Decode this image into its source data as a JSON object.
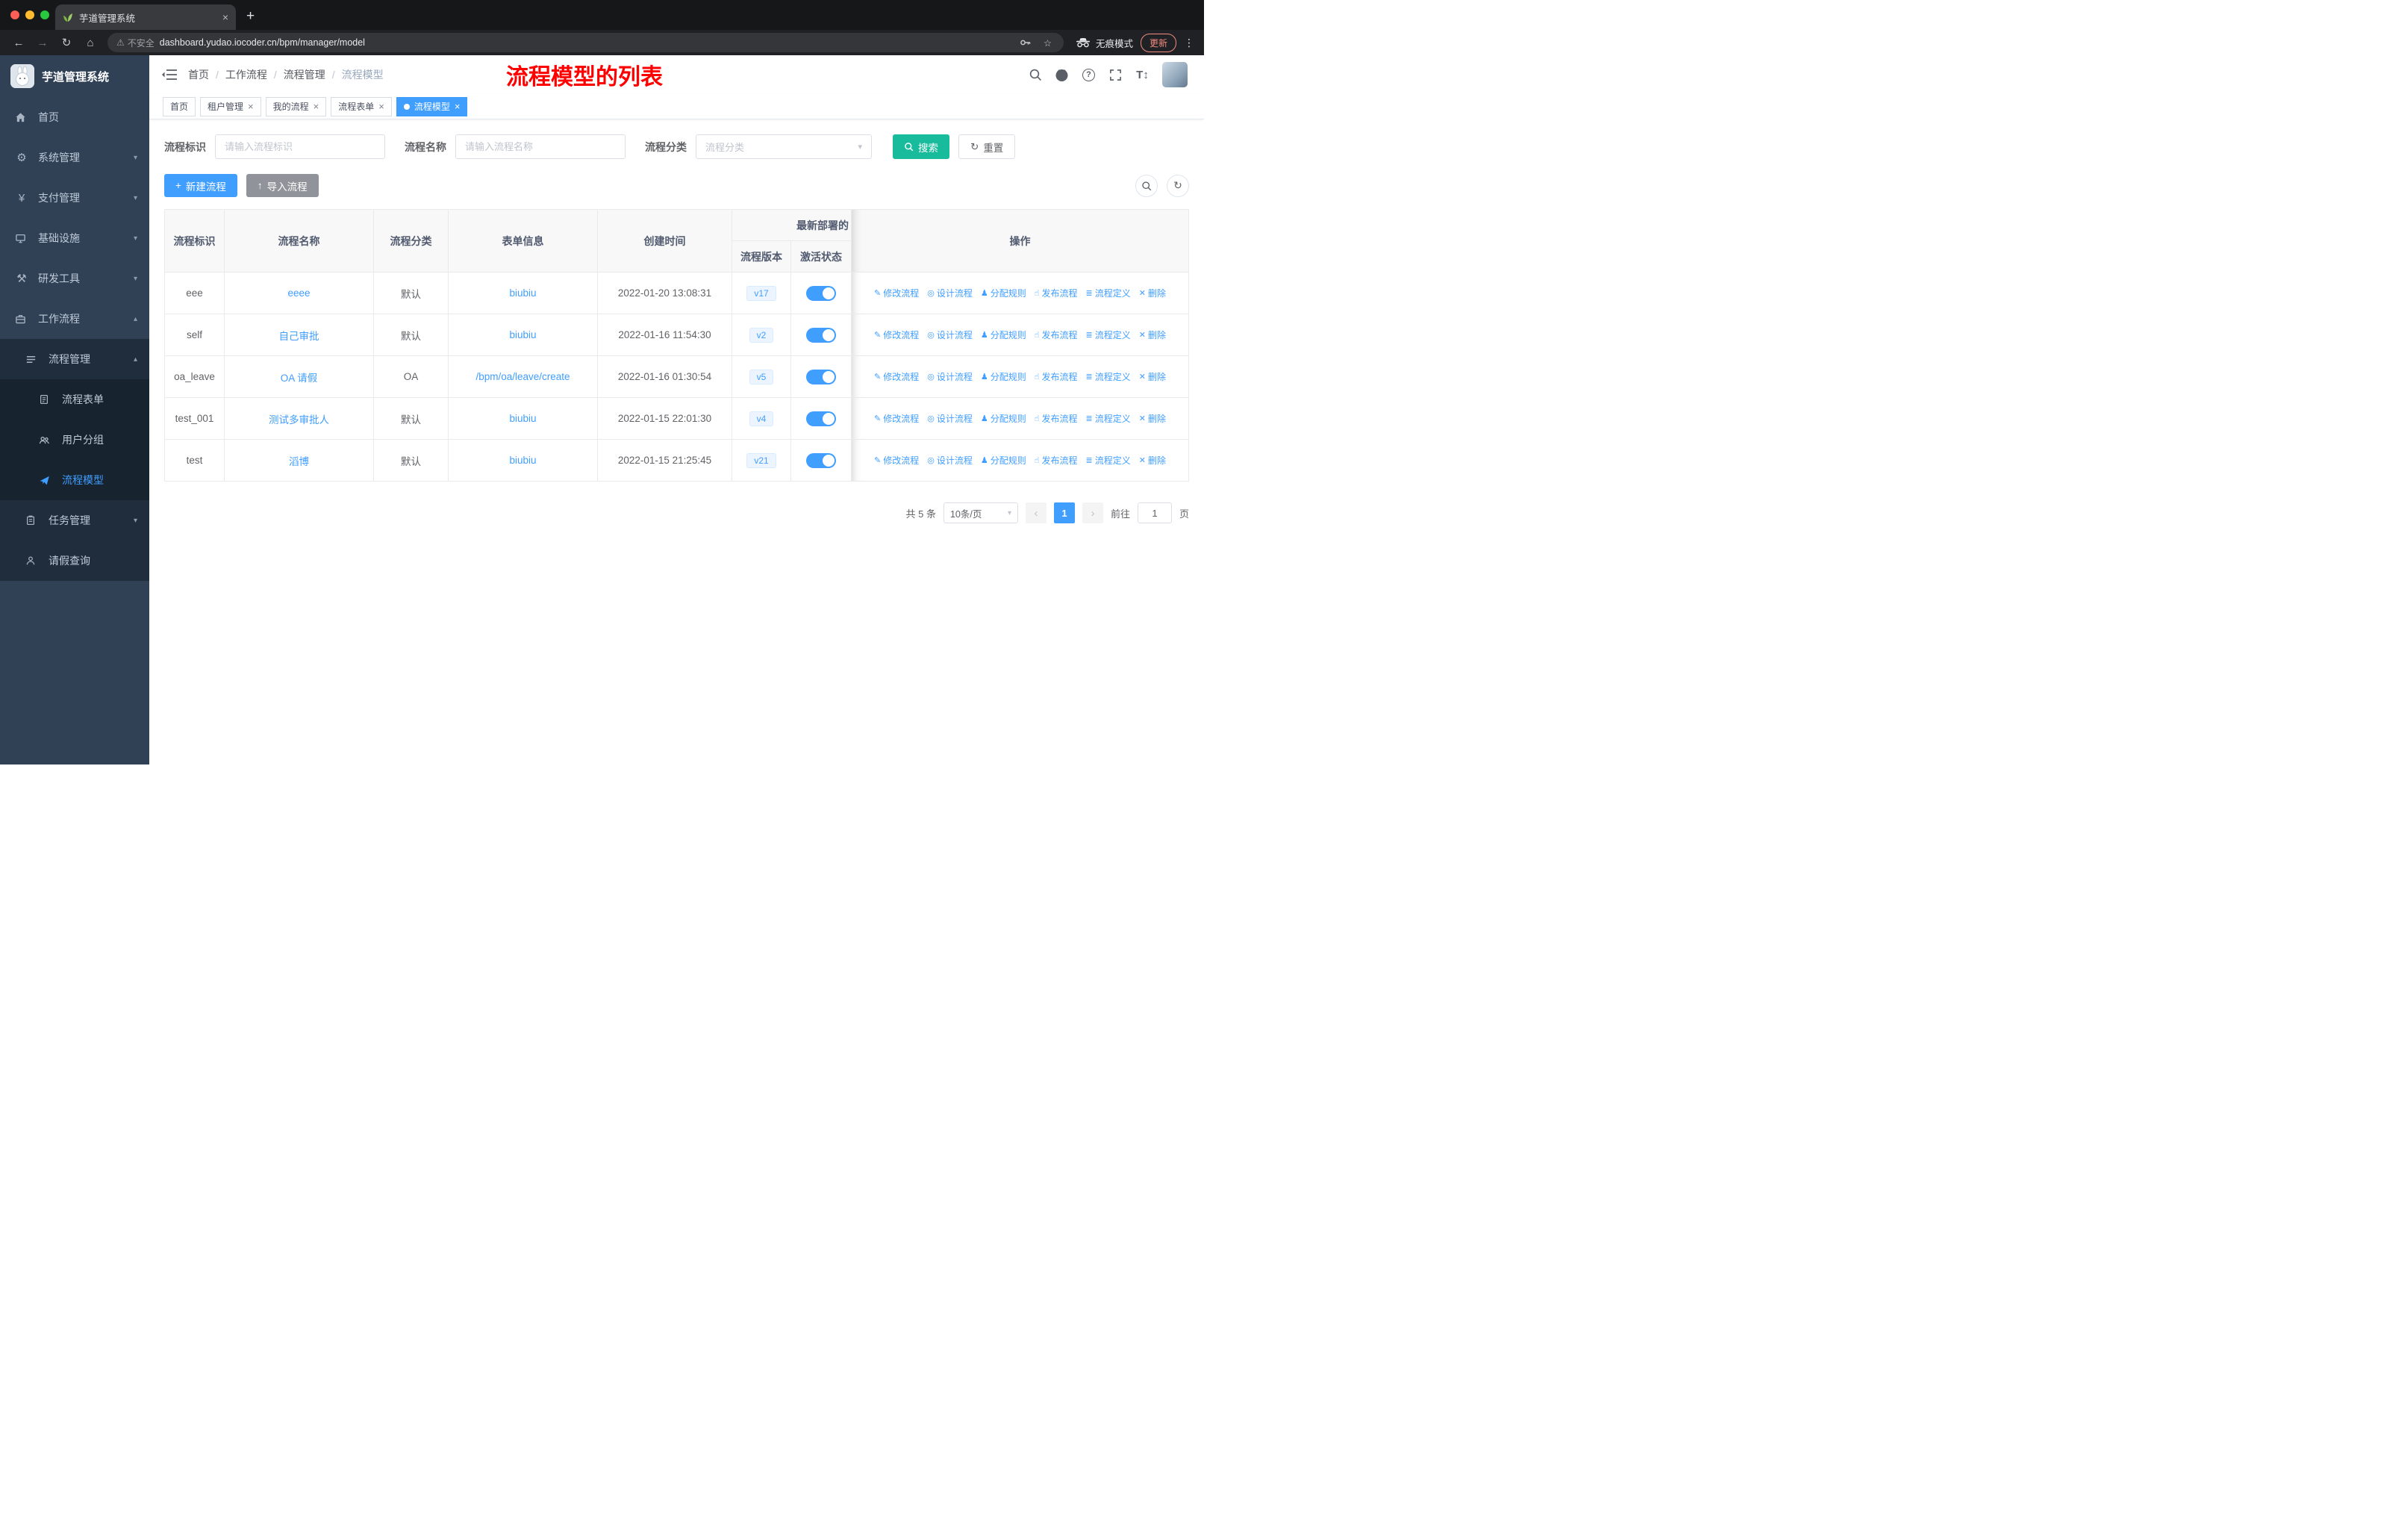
{
  "chrome": {
    "tab_title": "芋道管理系统",
    "security_label": "不安全",
    "url": "dashboard.yudao.iocoder.cn/bpm/manager/model",
    "incognito_label": "无痕模式",
    "update_label": "更新"
  },
  "sidebar": {
    "logo_title": "芋道管理系统",
    "menu": {
      "home": "首页",
      "system": "系统管理",
      "payment": "支付管理",
      "infra": "基础设施",
      "devtools": "研发工具",
      "workflow": "工作流程",
      "process_mgmt": "流程管理",
      "process_form": "流程表单",
      "user_group": "用户分组",
      "process_model": "流程模型",
      "task_mgmt": "任务管理",
      "leave_query": "请假查询"
    }
  },
  "header": {
    "breadcrumb": [
      "首页",
      "工作流程",
      "流程管理",
      "流程模型"
    ],
    "annotation": "流程模型的列表"
  },
  "tags": {
    "items": [
      {
        "key": "home",
        "label": "首页",
        "closable": false,
        "active": false
      },
      {
        "key": "tenant",
        "label": "租户管理",
        "closable": true,
        "active": false
      },
      {
        "key": "my-process",
        "label": "我的流程",
        "closable": true,
        "active": false
      },
      {
        "key": "process-form",
        "label": "流程表单",
        "closable": true,
        "active": false
      },
      {
        "key": "process-model",
        "label": "流程模型",
        "closable": true,
        "active": true
      }
    ]
  },
  "filters": {
    "fields": [
      {
        "label": "流程标识",
        "placeholder": "请输入流程标识"
      },
      {
        "label": "流程名称",
        "placeholder": "请输入流程名称"
      },
      {
        "label": "流程分类",
        "placeholder": "流程分类"
      }
    ],
    "search_label": "搜索",
    "reset_label": "重置"
  },
  "toolbar": {
    "create_label": "新建流程",
    "import_label": "导入流程"
  },
  "table": {
    "columns": {
      "id": "流程标识",
      "name": "流程名称",
      "category": "流程分类",
      "form": "表单信息",
      "created": "创建时间",
      "deploy_group": "最新部署的",
      "version": "流程版本",
      "status": "激活状态",
      "ops": "操作"
    },
    "actions": [
      {
        "key": "edit",
        "label": "修改流程",
        "icon": "edit-icon"
      },
      {
        "key": "design",
        "label": "设计流程",
        "icon": "design-icon"
      },
      {
        "key": "assign",
        "label": "分配规则",
        "icon": "assign-rule-icon"
      },
      {
        "key": "publish",
        "label": "发布流程",
        "icon": "publish-icon"
      },
      {
        "key": "definition",
        "label": "流程定义",
        "icon": "definition-icon"
      },
      {
        "key": "delete",
        "label": "删除",
        "icon": "delete-icon"
      }
    ],
    "rows": [
      {
        "id": "eee",
        "name": "eeee",
        "category": "默认",
        "form": "biubiu",
        "created": "2022-01-20 13:08:31",
        "version": "v17",
        "active": true
      },
      {
        "id": "self",
        "name": "自己审批",
        "category": "默认",
        "form": "biubiu",
        "created": "2022-01-16 11:54:30",
        "version": "v2",
        "active": true
      },
      {
        "id": "oa_leave",
        "name": "OA 请假",
        "category": "OA",
        "form": "/bpm/oa/leave/create",
        "created": "2022-01-16 01:30:54",
        "version": "v5",
        "active": true
      },
      {
        "id": "test_001",
        "name": "测试多审批人",
        "category": "默认",
        "form": "biubiu",
        "created": "2022-01-15 22:01:30",
        "version": "v4",
        "active": true
      },
      {
        "id": "test",
        "name": "滔博",
        "category": "默认",
        "form": "biubiu",
        "created": "2022-01-15 21:25:45",
        "version": "v21",
        "active": true
      }
    ]
  },
  "pagination": {
    "total": "共 5 条",
    "page_size": "10条/页",
    "prev": "‹",
    "next": "›",
    "current": "1",
    "goto_label": "前往",
    "goto_value": "1",
    "page_label": "页"
  },
  "colors": {
    "primary": "#409eff",
    "search": "#18bc9c",
    "sidebar": "#304156",
    "annotation": "#ff0000"
  }
}
